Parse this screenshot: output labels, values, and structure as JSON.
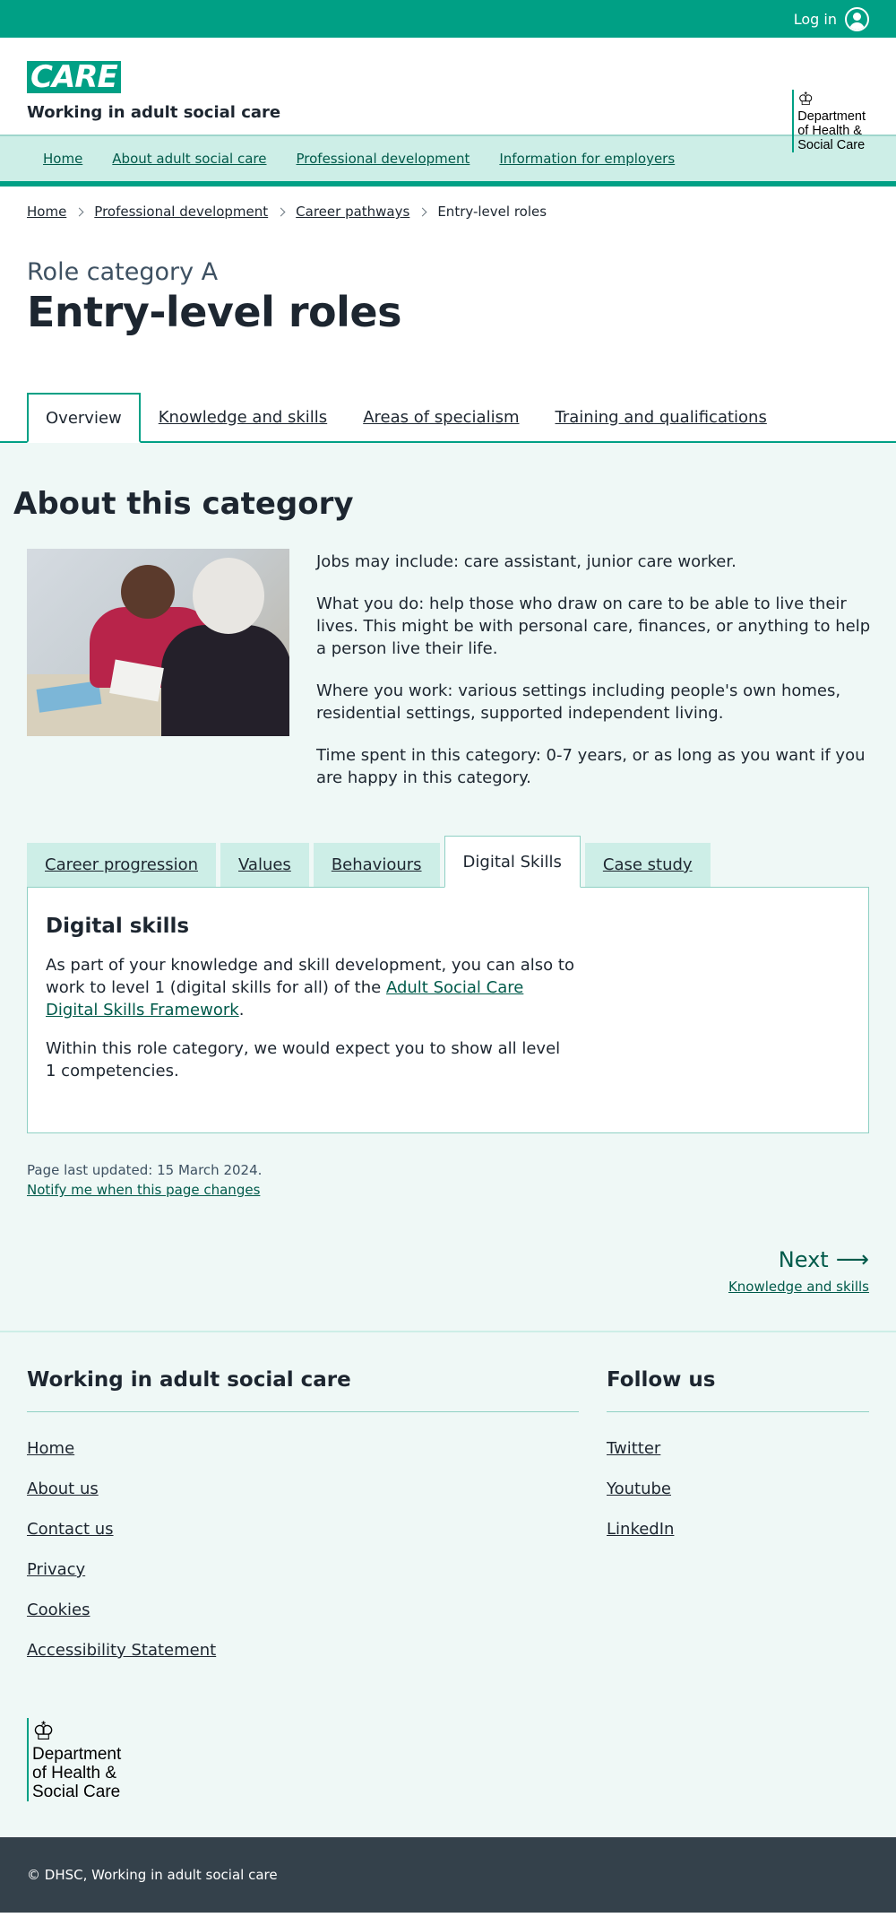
{
  "topbar": {
    "login_label": "Log in"
  },
  "header": {
    "logo_text": "CARE",
    "tagline": "Working in adult social care",
    "dhsc_lines": [
      "Department",
      "of Health &",
      "Social Care"
    ]
  },
  "nav": {
    "items": [
      {
        "label": "Home"
      },
      {
        "label": "About adult social care"
      },
      {
        "label": "Professional development"
      },
      {
        "label": "Information for employers"
      }
    ]
  },
  "breadcrumb": {
    "items": [
      {
        "label": "Home"
      },
      {
        "label": "Professional development"
      },
      {
        "label": "Career pathways"
      }
    ],
    "current": "Entry-level roles"
  },
  "title": {
    "role_category": "Role category A",
    "heading": "Entry-level roles"
  },
  "page_tabs": [
    {
      "label": "Overview",
      "active": true
    },
    {
      "label": "Knowledge and skills"
    },
    {
      "label": "Areas of specialism"
    },
    {
      "label": "Training and qualifications"
    }
  ],
  "about": {
    "heading": "About this category",
    "paragraphs": [
      "Jobs may include: care assistant, junior care worker.",
      "What you do: help those who draw on care to be able to live their lives. This might be with personal care, finances, or anything to help a person live their life.",
      "Where you work: various settings including people's own homes, residential settings, supported independent living.",
      "Time spent in this category: 0-7 years, or as long as you want if you are happy in this category."
    ]
  },
  "inner_tabs": [
    {
      "label": "Career progression"
    },
    {
      "label": "Values"
    },
    {
      "label": "Behaviours"
    },
    {
      "label": "Digital Skills",
      "active": true
    },
    {
      "label": "Case study"
    }
  ],
  "panel": {
    "heading": "Digital skills",
    "p1_before": "As part of your knowledge and skill development, you can also to work to level 1 (digital skills for all) of the ",
    "p1_link": "Adult Social Care Digital Skills Framework",
    "p1_after": ".",
    "p2": "Within this role category, we would expect you to show all level 1 competencies."
  },
  "meta": {
    "updated": "Page last updated: 15 March 2024.",
    "notify": "Notify me when this page changes"
  },
  "next": {
    "label": "Next",
    "sub": "Knowledge and skills"
  },
  "footer": {
    "left_heading": "Working in adult social care",
    "left_links": [
      "Home",
      "About us",
      "Contact us",
      "Privacy",
      "Cookies",
      "Accessibility Statement"
    ],
    "right_heading": "Follow us",
    "right_links": [
      "Twitter",
      "Youtube",
      "LinkedIn"
    ],
    "copyright": "© DHSC, Working in adult social care"
  },
  "colors": {
    "brand_green": "#00a085",
    "nav_bg": "#cdeee7",
    "section_bg": "#eff8f6",
    "link_green": "#005a4a",
    "footer_dark": "#34414b"
  }
}
